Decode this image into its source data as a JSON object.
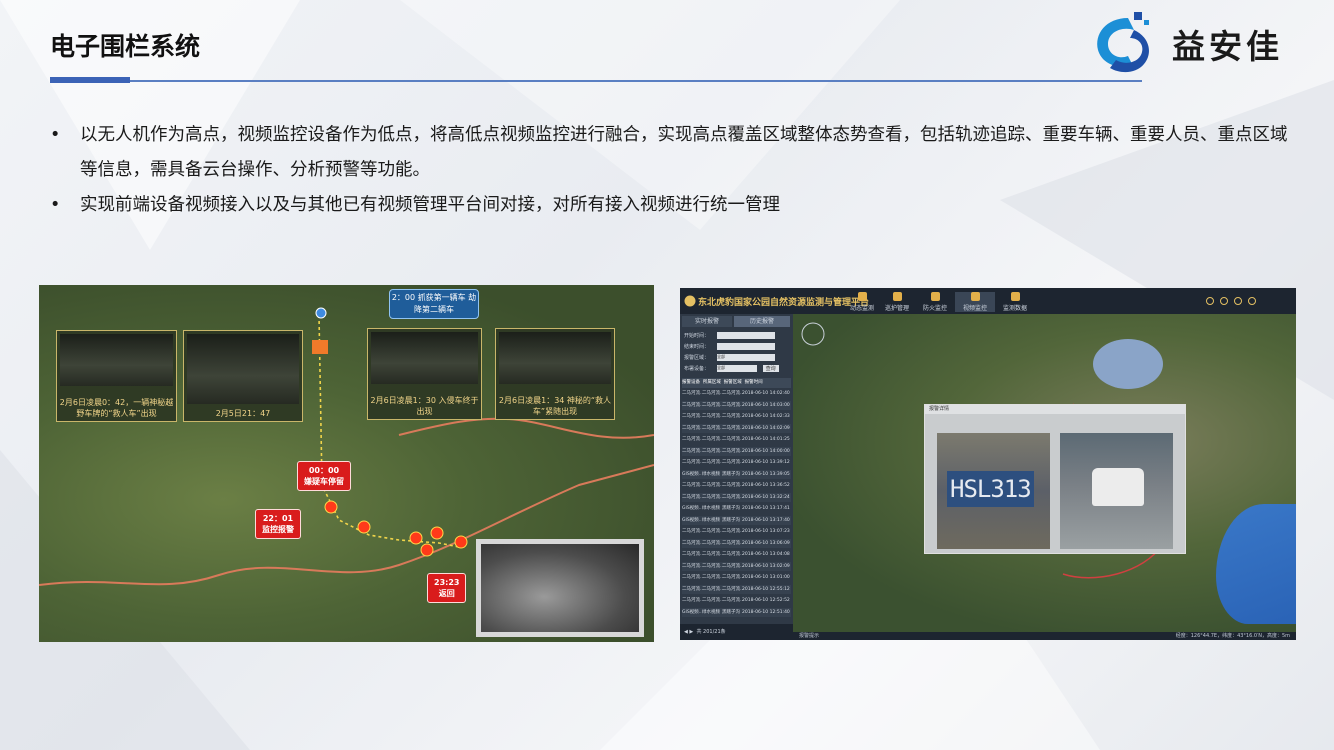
{
  "slide": {
    "title": "电子围栏系统",
    "logo_text": "益安佳",
    "bullets": [
      "以无人机作为高点，视频监控设备作为低点，将高低点视频监控进行融合，实现高点覆盖区域整体态势查看，包括轨迹追踪、重要车辆、重要人员、重点区域等信息，需具备云台操作、分析预警等功能。",
      "实现前端设备视频接入以及与其他已有视频管理平台间对接，对所有接入视频进行统一管理"
    ]
  },
  "screenshot_left": {
    "top_note": "2：00 抓获第一辆车 劫降第二辆车",
    "captures": [
      {
        "text": "2月6日凌晨0：42，一辆神秘越 野车牌的“救人车”出现"
      },
      {
        "text": "2月5日21：47"
      },
      {
        "text": "2月6日凌晨1：30 入侵车终于出现"
      },
      {
        "text": "2月6日凌晨1：34 神秘的“救人车”紧随出现"
      }
    ],
    "events": [
      {
        "time": "00：00",
        "label": "嫌疑车停留"
      },
      {
        "time": "22：01",
        "label": "监控报警"
      },
      {
        "time": "23:23",
        "label": "返回"
      }
    ]
  },
  "screenshot_right": {
    "app_title": "东北虎豹国家公园自然资源监测与管理平台",
    "nav": [
      "动态监测",
      "巡护管理",
      "防火监控",
      "视频监控",
      "监测数据"
    ],
    "side_tabs": [
      "实时报警",
      "历史报警"
    ],
    "form_labels": [
      "开始时间：",
      "结束时间：",
      "报警区域：",
      "布署设备："
    ],
    "form_values": [
      "",
      "",
      "全部",
      "全部"
    ],
    "query_btn": "查询",
    "table_headers": [
      "报警设备",
      "所属区域",
      "报警区域",
      "报警时间"
    ],
    "table_rows": [
      [
        "二马河流...",
        "二马河流...",
        "二马河流...",
        "2018-06-10 14:02:40"
      ],
      [
        "二马河流...",
        "二马河流...",
        "二马河流...",
        "2018-06-10 14:03:00"
      ],
      [
        "二马河流...",
        "二马河流...",
        "二马河流...",
        "2018-06-10 14:02:33"
      ],
      [
        "二马河流...",
        "二马河流...",
        "二马河流...",
        "2018-06-10 14:02:09"
      ],
      [
        "二马河流...",
        "二马河流...",
        "二马河流...",
        "2018-06-10 14:01:25"
      ],
      [
        "二马河流...",
        "二马河流...",
        "二马河流...",
        "2018-06-10 14:00:00"
      ],
      [
        "二马河流...",
        "二马河流...",
        "二马河流...",
        "2018-06-10 13:39:12"
      ],
      [
        "GIS视频...",
        "绿水视频",
        "黑瞎子沟",
        "2018-06-10 13:39:05"
      ],
      [
        "二马河流...",
        "二马河流...",
        "二马河流...",
        "2018-06-10 13:36:52"
      ],
      [
        "二马河流...",
        "二马河流...",
        "二马河流...",
        "2018-06-10 13:32:24"
      ],
      [
        "GIS视频...",
        "绿水视频",
        "黑瞎子沟",
        "2018-06-10 13:17:41"
      ],
      [
        "GIS视频...",
        "绿水视频",
        "黑瞎子沟",
        "2018-06-10 13:17:40"
      ],
      [
        "二马河流...",
        "二马河流...",
        "二马河流...",
        "2018-06-10 13:07:23"
      ],
      [
        "二马河流...",
        "二马河流...",
        "二马河流...",
        "2018-06-10 13:06:09"
      ],
      [
        "二马河流...",
        "二马河流...",
        "二马河流...",
        "2018-06-10 13:04:08"
      ],
      [
        "二马河流...",
        "二马河流...",
        "二马河流...",
        "2018-06-10 13:02:09"
      ],
      [
        "二马河流...",
        "二马河流...",
        "二马河流...",
        "2018-06-10 13:01:00"
      ],
      [
        "二马河流...",
        "二马河流...",
        "二马河流...",
        "2018-06-10 12:55:12"
      ],
      [
        "二马河流...",
        "二马河流...",
        "二马河流...",
        "2018-06-10 12:52:52"
      ],
      [
        "GIS视频...",
        "绿水视频",
        "黑瞎子沟",
        "2018-06-10 12:51:40"
      ]
    ],
    "popup_title": "报警详情",
    "plate_text": "HSL313",
    "pager": "共 201/21条",
    "status_left": "报警提示",
    "status_right": "经度：126°44.7E，纬度：43°16.0′N，高度：5m"
  }
}
